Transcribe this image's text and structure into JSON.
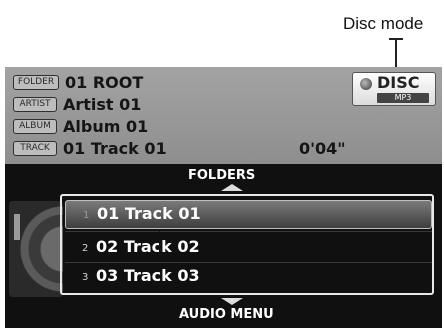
{
  "callout": {
    "label": "Disc mode"
  },
  "info": {
    "folder": {
      "tag": "FOLDER",
      "value": "01 ROOT"
    },
    "artist": {
      "tag": "ARTIST",
      "value": "Artist 01"
    },
    "album": {
      "tag": "ALBUM",
      "value": "Album 01"
    },
    "track": {
      "tag": "TRACK",
      "value": "01 Track 01",
      "elapsed": "0'04\""
    }
  },
  "mode_badge": {
    "label": "DISC",
    "format": "MP3",
    "icon": "disc-icon"
  },
  "list": {
    "header": "FOLDERS",
    "footer": "AUDIO MENU",
    "tracks": [
      {
        "number": "1",
        "name": "01 Track 01",
        "selected": true
      },
      {
        "number": "2",
        "name": "02 Track 02",
        "selected": false
      },
      {
        "number": "3",
        "name": "03 Track 03",
        "selected": false
      }
    ]
  },
  "colors": {
    "screen_bg": "#101010",
    "info_bg": "#9a9a9a",
    "text_light": "#ffffff",
    "text_dark": "#151515"
  }
}
